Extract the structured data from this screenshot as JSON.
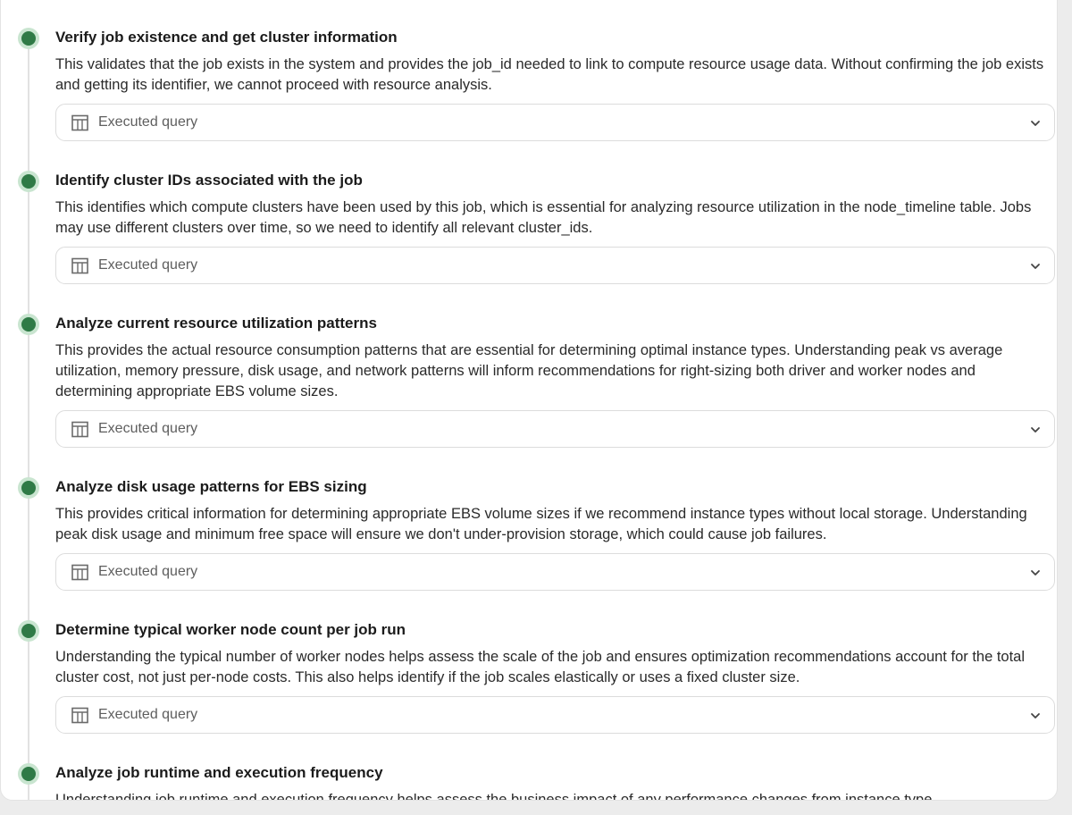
{
  "steps": [
    {
      "title": "Verify job existence and get cluster information",
      "description": "This validates that the job exists in the system and provides the job_id needed to link to compute resource usage data. Without confirming the job exists and getting its identifier, we cannot proceed with resource analysis.",
      "query_label": "Executed query"
    },
    {
      "title": "Identify cluster IDs associated with the job",
      "description": "This identifies which compute clusters have been used by this job, which is essential for analyzing resource utilization in the node_timeline table. Jobs may use different clusters over time, so we need to identify all relevant cluster_ids.",
      "query_label": "Executed query"
    },
    {
      "title": "Analyze current resource utilization patterns",
      "description": "This provides the actual resource consumption patterns that are essential for determining optimal instance types. Understanding peak vs average utilization, memory pressure, disk usage, and network patterns will inform recommendations for right-sizing both driver and worker nodes and determining appropriate EBS volume sizes.",
      "query_label": "Executed query"
    },
    {
      "title": "Analyze disk usage patterns for EBS sizing",
      "description": "This provides critical information for determining appropriate EBS volume sizes if we recommend instance types without local storage. Understanding peak disk usage and minimum free space will ensure we don't under-provision storage, which could cause job failures.",
      "query_label": "Executed query"
    },
    {
      "title": "Determine typical worker node count per job run",
      "description": "Understanding the typical number of worker nodes helps assess the scale of the job and ensures optimization recommendations account for the total cluster cost, not just per-node costs. This also helps identify if the job scales elastically or uses a fixed cluster size.",
      "query_label": "Executed query"
    },
    {
      "title": "Analyze job runtime and execution frequency",
      "description": "Understanding job runtime and execution frequency helps assess the business impact of any performance changes from instance type"
    }
  ],
  "icons": {
    "step_marker": "status-dot-icon",
    "query": "table-icon",
    "expand": "chevron-down-icon"
  },
  "colors": {
    "step_dot": "#2f7a46",
    "step_dot_halo": "#c9e5d0"
  }
}
